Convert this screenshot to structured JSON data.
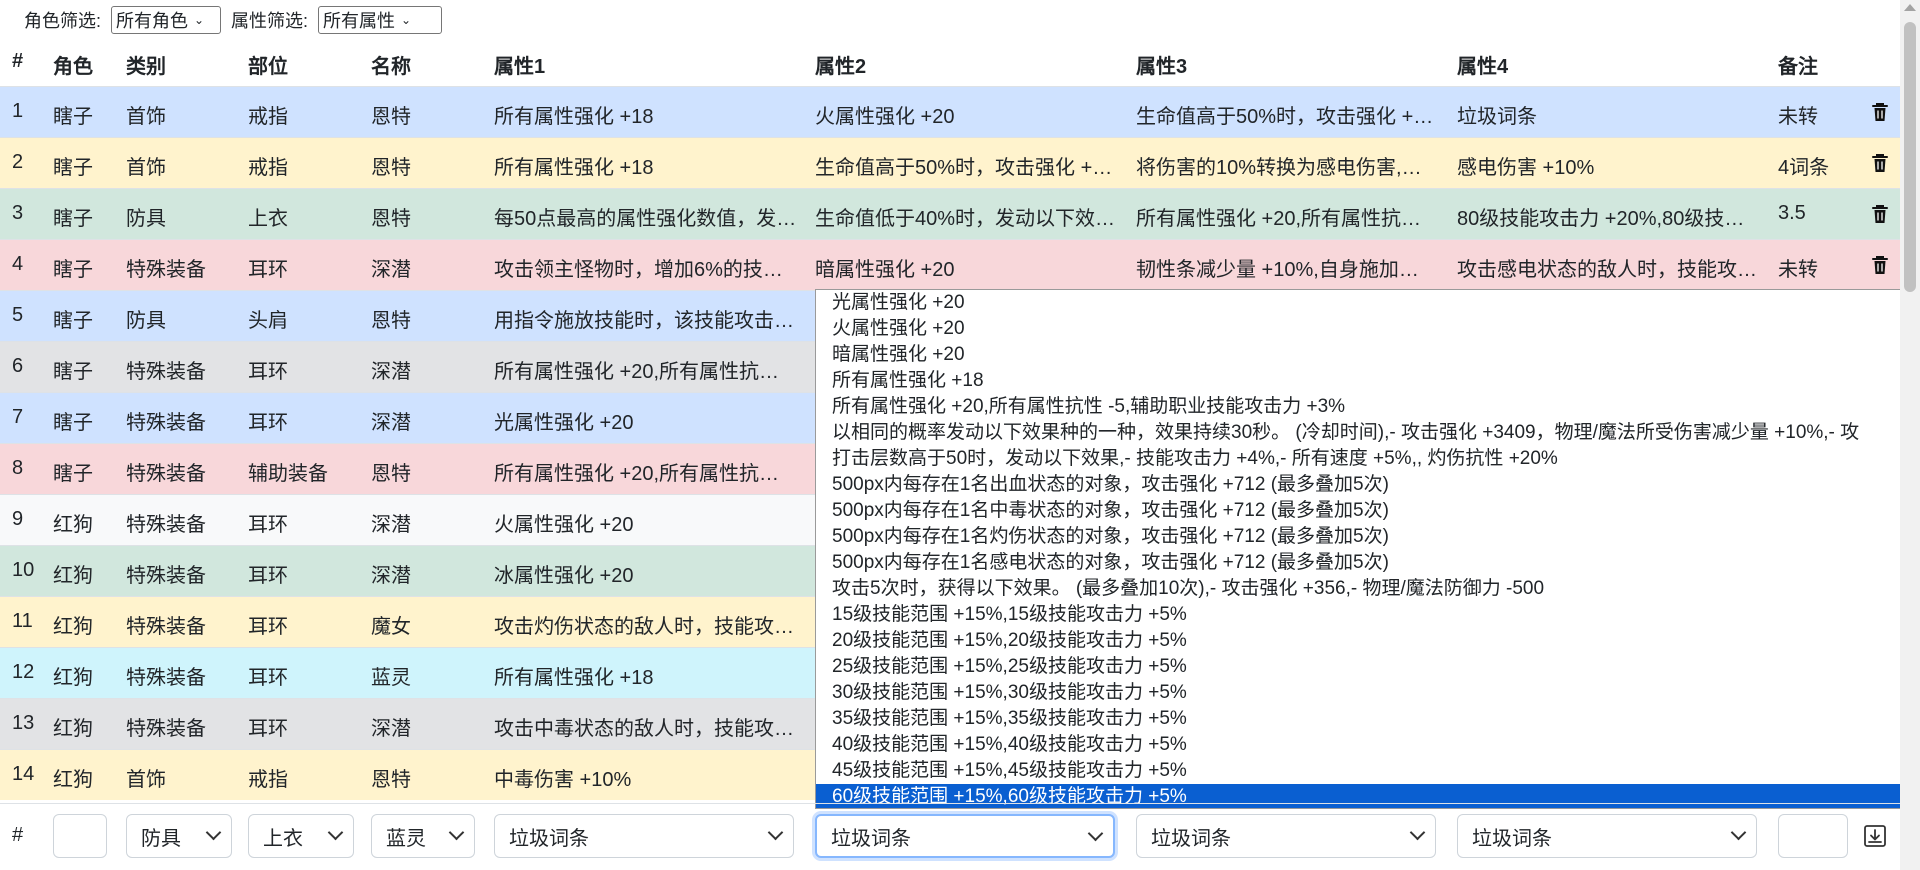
{
  "filters": {
    "role_label": "角色筛选:",
    "role_value": "所有角色",
    "attr_label": "属性筛选:",
    "attr_value": "所有属性"
  },
  "columns": [
    "#",
    "角色",
    "类别",
    "部位",
    "名称",
    "属性1",
    "属性2",
    "属性3",
    "属性4",
    "备注"
  ],
  "colors": {
    "blue": "#cfe2ff",
    "yellow": "#fff3cd",
    "green": "#d1e7dd",
    "red": "#f8d7da",
    "gray": "#e2e3e5",
    "light": "#f8f9fa",
    "cyan": "#cff4fc",
    "selected": "#0a5fd1"
  },
  "rows": [
    {
      "idx": "1",
      "role": "瞎子",
      "cat": "首饰",
      "part": "戒指",
      "name": "恩特",
      "a1": "所有属性强化 +18",
      "a2": "火属性强化 +20",
      "a3": "生命值高于50%时，攻击强化 +…",
      "a4": "垃圾词条",
      "note": "未转",
      "color": "blue",
      "trash": true
    },
    {
      "idx": "2",
      "role": "瞎子",
      "cat": "首饰",
      "part": "戒指",
      "name": "恩特",
      "a1": "所有属性强化 +18",
      "a2": "生命值高于50%时，攻击强化 +…",
      "a3": "将伤害的10%转换为感电伤害,…",
      "a4": "感电伤害 +10%",
      "note": "4词条",
      "color": "yellow",
      "trash": true
    },
    {
      "idx": "3",
      "role": "瞎子",
      "cat": "防具",
      "part": "上衣",
      "name": "恩特",
      "a1": "每50点最高的属性强化数值，发…",
      "a2": "生命值低于40%时，发动以下效…",
      "a3": "所有属性强化 +20,所有属性抗…",
      "a4": "80级技能攻击力 +20%,80级技…",
      "note": "3.5",
      "color": "green",
      "trash": true
    },
    {
      "idx": "4",
      "role": "瞎子",
      "cat": "特殊装备",
      "part": "耳环",
      "name": "深潜",
      "a1": "攻击领主怪物时，增加6%的技…",
      "a2": "暗属性强化 +20",
      "a3": "韧性条减少量 +10%,自身施加…",
      "a4": "攻击感电状态的敌人时，技能攻…",
      "note": "未转",
      "color": "red",
      "trash": true
    },
    {
      "idx": "5",
      "role": "瞎子",
      "cat": "防具",
      "part": "头肩",
      "name": "恩特",
      "a1": "用指令施放技能时，该技能攻击…",
      "a2": "",
      "a3": "",
      "a4": "",
      "note": "",
      "color": "blue",
      "trash": false
    },
    {
      "idx": "6",
      "role": "瞎子",
      "cat": "特殊装备",
      "part": "耳环",
      "name": "深潜",
      "a1": "所有属性强化 +20,所有属性抗…",
      "a2": "",
      "a3": "",
      "a4": "",
      "note": "",
      "color": "gray",
      "trash": false
    },
    {
      "idx": "7",
      "role": "瞎子",
      "cat": "特殊装备",
      "part": "耳环",
      "name": "深潜",
      "a1": "光属性强化 +20",
      "a2": "",
      "a3": "",
      "a4": "",
      "note": "",
      "color": "blue",
      "trash": false
    },
    {
      "idx": "8",
      "role": "瞎子",
      "cat": "特殊装备",
      "part": "辅助装备",
      "name": "恩特",
      "a1": "所有属性强化 +20,所有属性抗…",
      "a2": "",
      "a3": "",
      "a4": "",
      "note": "",
      "color": "red",
      "trash": false
    },
    {
      "idx": "9",
      "role": "红狗",
      "cat": "特殊装备",
      "part": "耳环",
      "name": "深潜",
      "a1": "火属性强化 +20",
      "a2": "",
      "a3": "",
      "a4": "",
      "note": "",
      "color": "light",
      "trash": false
    },
    {
      "idx": "10",
      "role": "红狗",
      "cat": "特殊装备",
      "part": "耳环",
      "name": "深潜",
      "a1": "冰属性强化 +20",
      "a2": "",
      "a3": "",
      "a4": "",
      "note": "",
      "color": "green",
      "trash": false
    },
    {
      "idx": "11",
      "role": "红狗",
      "cat": "特殊装备",
      "part": "耳环",
      "name": "魔女",
      "a1": "攻击灼伤状态的敌人时，技能攻…",
      "a2": "",
      "a3": "",
      "a4": "",
      "note": "",
      "color": "yellow",
      "trash": false
    },
    {
      "idx": "12",
      "role": "红狗",
      "cat": "特殊装备",
      "part": "耳环",
      "name": "蓝灵",
      "a1": "所有属性强化 +18",
      "a2": "",
      "a3": "",
      "a4": "",
      "note": "",
      "color": "cyan",
      "trash": false
    },
    {
      "idx": "13",
      "role": "红狗",
      "cat": "特殊装备",
      "part": "耳环",
      "name": "深潜",
      "a1": "攻击中毒状态的敌人时，技能攻…",
      "a2": "",
      "a3": "",
      "a4": "",
      "note": "",
      "color": "gray",
      "trash": false
    },
    {
      "idx": "14",
      "role": "红狗",
      "cat": "首饰",
      "part": "戒指",
      "name": "恩特",
      "a1": "中毒伤害 +10%",
      "a2": "",
      "a3": "",
      "a4": "",
      "note": "",
      "color": "yellow",
      "trash": false
    }
  ],
  "dropdown": {
    "options": [
      "光属性强化 +20",
      "火属性强化 +20",
      "暗属性强化 +20",
      "所有属性强化 +18",
      "所有属性强化 +20,所有属性抗性 -5,辅助职业技能攻击力 +3%",
      "以相同的概率发动以下效果种的一种，效果持续30秒。 (冷却时间),- 攻击强化 +3409，物理/魔法所受伤害减少量 +10%,- 攻",
      "打击层数高于50时，发动以下效果,- 技能攻击力 +4%,- 所有速度 +5%,, 灼伤抗性 +20%",
      "500px内每存在1名出血状态的对象，攻击强化 +712 (最多叠加5次)",
      "500px内每存在1名中毒状态的对象，攻击强化 +712 (最多叠加5次)",
      "500px内每存在1名灼伤状态的对象，攻击强化 +712 (最多叠加5次)",
      "500px内每存在1名感电状态的对象，攻击强化 +712 (最多叠加5次)",
      "攻击5次时，获得以下效果。 (最多叠加10次),- 攻击强化 +356,- 物理/魔法防御力 -500",
      "15级技能范围 +15%,15级技能攻击力 +5%",
      "20级技能范围 +15%,20级技能攻击力 +5%",
      "25级技能范围 +15%,25级技能攻击力 +5%",
      "30级技能范围 +15%,30级技能攻击力 +5%",
      "35级技能范围 +15%,35级技能攻击力 +5%",
      "40级技能范围 +15%,40级技能攻击力 +5%",
      "45级技能范围 +15%,45级技能攻击力 +5%",
      "60级技能范围 +15%,60级技能攻击力 +5%"
    ],
    "selected_index": 19
  },
  "add_row": {
    "hash": "#",
    "role_value": "",
    "cat_value": "防具",
    "part_value": "上衣",
    "name_value": "蓝灵",
    "a1_value": "垃圾词条",
    "a2_value": "垃圾词条",
    "a3_value": "垃圾词条",
    "a4_value": "垃圾词条",
    "note_value": ""
  },
  "icons": {
    "delete": "trash-icon",
    "save": "save-icon",
    "dropdown": "chevron-down-icon"
  }
}
